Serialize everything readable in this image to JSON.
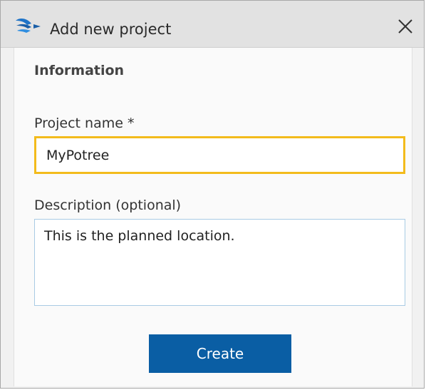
{
  "window": {
    "title": "Add new project",
    "app_icon": "trimble-swirl-icon",
    "close_icon": "close-icon"
  },
  "form": {
    "section_title": "Information",
    "project_name_label": "Project name *",
    "project_name_value": "MyPotree",
    "description_label": "Description (optional)",
    "description_value": "This is the planned location.",
    "create_label": "Create"
  },
  "colors": {
    "accent": "#0a5ea4",
    "focus_border": "#f3bb1c",
    "input_border": "#a9cbe4"
  }
}
